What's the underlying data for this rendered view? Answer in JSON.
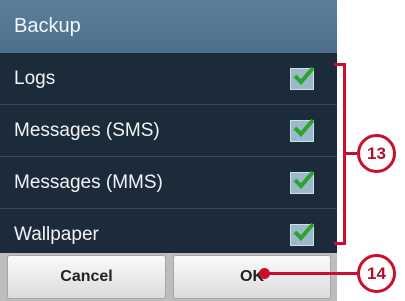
{
  "dialog": {
    "title": "Backup",
    "items": [
      {
        "label": "Logs",
        "checked": true
      },
      {
        "label": "Messages (SMS)",
        "checked": true
      },
      {
        "label": "Messages (MMS)",
        "checked": true
      },
      {
        "label": "Wallpaper",
        "checked": true
      }
    ],
    "buttons": {
      "cancel": "Cancel",
      "ok": "OK"
    }
  },
  "callouts": {
    "group": "13",
    "ok": "14"
  },
  "colors": {
    "accent": "#c8102e",
    "checkmark": "#2ea12e",
    "dialog_bg": "#1c2b3a",
    "title_bg": "#56778f"
  }
}
